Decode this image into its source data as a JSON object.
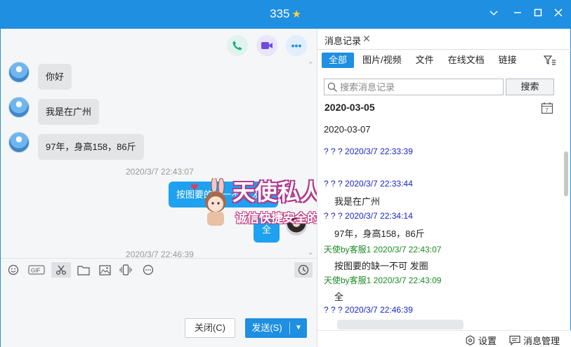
{
  "window": {
    "title": "335",
    "star": "★"
  },
  "chat": {
    "messages": [
      {
        "text": "你好",
        "dir": "in"
      },
      {
        "text": "我是在广州",
        "dir": "in"
      },
      {
        "text": "97年，身高158，86斤",
        "dir": "in"
      },
      {
        "text": "按图要的缺一不可 发圈",
        "dir": "out"
      },
      {
        "text": "全",
        "dir": "out"
      }
    ],
    "timestamps": [
      "2020/3/7 22:43:07",
      "2020/3/7 22:46:39"
    ],
    "buttons": {
      "close": "关闭(C)",
      "send": "发送(S)"
    }
  },
  "history": {
    "tab_title": "消息记录",
    "filters": [
      "全部",
      "图片/视频",
      "文件",
      "在线文档",
      "链接"
    ],
    "search_placeholder": "搜索消息记录",
    "search_button": "搜索",
    "date_bold": "2020-03-05",
    "date_plain": "2020-03-07",
    "entries": [
      {
        "header": "? ? ?  2020/3/7 22:33:39",
        "color": "blue"
      },
      {
        "header": "? ? ?  2020/3/7 22:33:44",
        "color": "blue"
      },
      {
        "text": "我是在广州"
      },
      {
        "header": "? ? ?  2020/3/7 22:34:14",
        "color": "blue"
      },
      {
        "text": "97年，身高158，86斤"
      },
      {
        "header": "天使by客服1 2020/3/7 22:43:07",
        "color": "green"
      },
      {
        "text": "按图要的缺一不可 发圈"
      },
      {
        "header": "天使by客服1 2020/3/7 22:43:09",
        "color": "green"
      },
      {
        "text": "全"
      },
      {
        "header": "? ? ?  2020/3/7 22:46:39",
        "color": "blue"
      }
    ],
    "footer": {
      "settings": "设置",
      "manage": "消息管理"
    }
  },
  "watermark": {
    "line1": "天使私人订制",
    "line2": "诚信快捷安全的交友平台"
  },
  "colors": {
    "accent": "#1e8fe1",
    "bubble_out": "#1ea1ee",
    "header_blue": "#1a24c8",
    "header_green": "#1b8a26"
  }
}
